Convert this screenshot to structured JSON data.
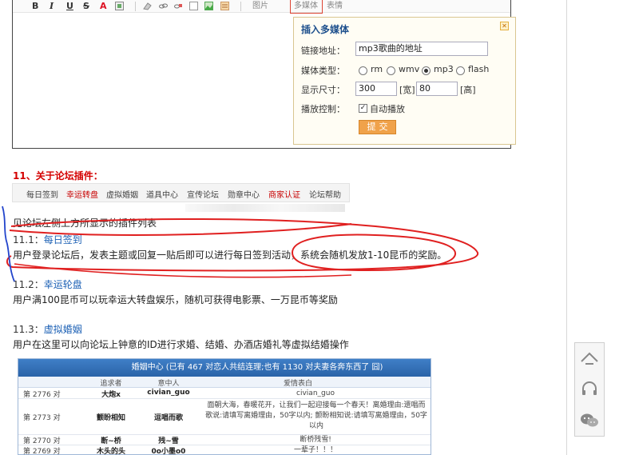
{
  "editor": {
    "toolbar": {
      "bold": "B",
      "italic": "I",
      "underline": "U",
      "strike": "S",
      "font_color": "A",
      "image_label": "图片",
      "media_label": "多媒体",
      "emoji_label": "表情"
    },
    "media_popup": {
      "title": "插入多媒体",
      "url_label": "链接地址：",
      "url_value": "mp3歌曲的地址",
      "type_label": "媒体类型：",
      "types": [
        "rm",
        "wmv",
        "mp3",
        "flash"
      ],
      "selected_type": "mp3",
      "size_label": "显示尺寸：",
      "width_value": "300",
      "width_unit": "[宽]",
      "height_value": "80",
      "height_unit": "[高]",
      "play_label": "播放控制：",
      "autoplay_label": "自动播放",
      "autoplay_checked": true,
      "submit_label": "提交"
    }
  },
  "section": {
    "title": "11、关于论坛插件：",
    "plugin_tabs": [
      "每日签到",
      "幸运转盘",
      "虚拟婚姻",
      "道具中心",
      "宣传论坛",
      "勋章中心",
      "商家认证",
      "论坛帮助"
    ],
    "hot_tabs": [
      "幸运转盘",
      "商家认证"
    ],
    "intro": "见论坛左侧上方所显示的插件列表",
    "items": [
      {
        "prefix": "11.1：",
        "link": "每日签到",
        "desc": "用户登录论坛后，发表主题或回复一贴后即可以进行每日签到活动，系统会随机发放1-10昆币的奖励。"
      },
      {
        "prefix": "11.2：",
        "link": "幸运轮盘",
        "desc": "用户满100昆币可以玩幸运大转盘娱乐，随机可获得电影票、一万昆币等奖励"
      },
      {
        "prefix": "11.3：",
        "link": "虚拟婚姻",
        "desc": "用户在这里可以向论坛上钟意的ID进行求婚、结婚、办酒店婚礼等虚拟结婚操作"
      }
    ]
  },
  "wedding": {
    "header": "婚姻中心 (已有 467 对恋人共结连理;也有 1130 对夫妻各奔东西了 囧)",
    "columns": [
      "追求者",
      "意中人",
      "爱情表白"
    ],
    "rows": [
      {
        "num": "第 2776 对",
        "suitor": "大炮x",
        "beloved": "civian_guo",
        "message": "civian_guo"
      },
      {
        "num": "第 2773 对",
        "suitor": "颤盼相知",
        "beloved": "逗唱而歌",
        "message": "面朝大海，春暖花开，让我们一起迎接每一个春天！离婚理由:遗唱而歌说:请填写离婚理由，50字以内; 颤盼相知说:请填写离婚理由，50字以内"
      },
      {
        "num": "第 2770 对",
        "suitor": "断~桥",
        "beloved": "残~雪",
        "message": "断桥残雪!"
      },
      {
        "num": "第 2769 对",
        "suitor": "木头的头",
        "beloved": "0o小墨o0",
        "message": "一辈子！！！"
      }
    ]
  },
  "side_tools": [
    "top-arrow-icon",
    "headset-icon",
    "wechat-icon"
  ],
  "colors": {
    "section_title": "#d40000",
    "link": "#1a5fb4",
    "annotation_red": "#e02020",
    "annotation_blue": "#2244cc",
    "popup_title": "#1d4f8c",
    "submit": "#f0a24a",
    "wedding_header": "#2a63a8"
  }
}
